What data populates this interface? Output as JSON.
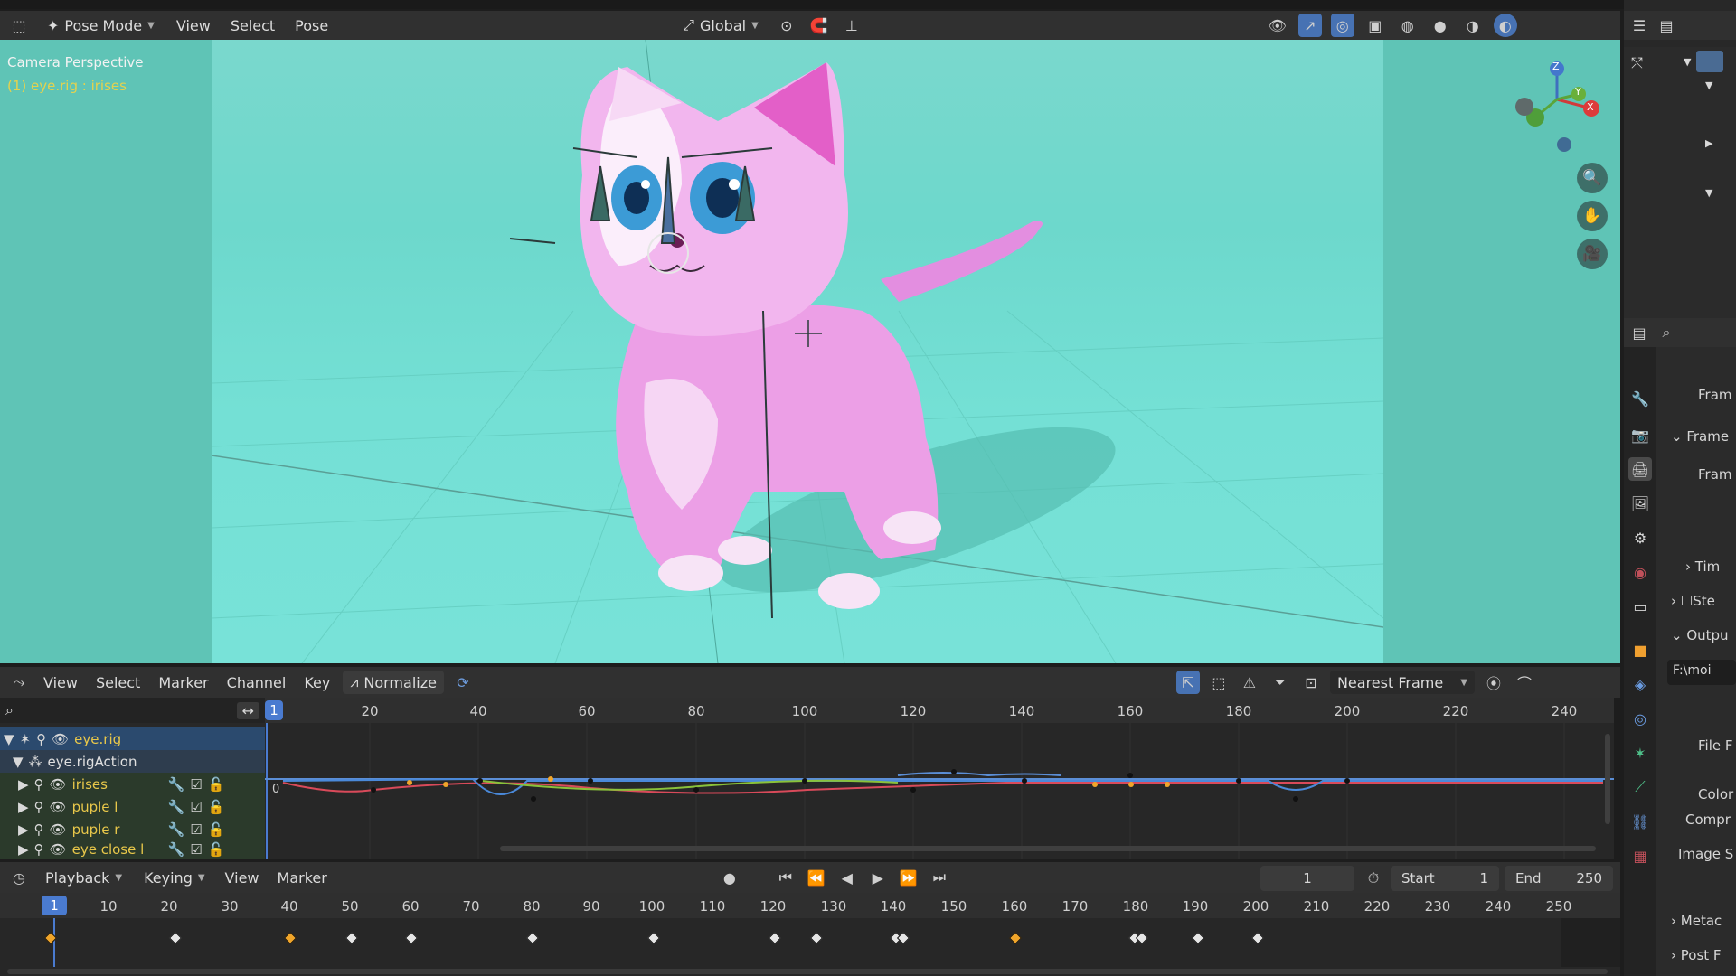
{
  "header": {
    "mode": "Pose Mode",
    "menus": [
      "View",
      "Select",
      "Pose"
    ],
    "orientation": "Global"
  },
  "viewport": {
    "perspective_label": "Camera Perspective",
    "object_label": "(1) eye.rig : irises",
    "gizmo_axes": {
      "z": "Z",
      "y": "Y",
      "x": "X"
    },
    "nav_icons": [
      "zoom-icon",
      "hand-pan-icon",
      "camera-icon"
    ]
  },
  "graph_editor": {
    "menus": [
      "View",
      "Select",
      "Marker",
      "Channel",
      "Key"
    ],
    "normalize_label": "Normalize",
    "snap_mode": "Nearest Frame",
    "current_frame": "1",
    "ruler_ticks": [
      "20",
      "40",
      "60",
      "80",
      "100",
      "120",
      "140",
      "160",
      "180",
      "200",
      "220",
      "240"
    ],
    "zero_label": "0",
    "channels": [
      {
        "label": "eye.rig",
        "level": 0
      },
      {
        "label": "eye.rigAction",
        "level": 1
      },
      {
        "label": "irises",
        "level": 2
      },
      {
        "label": "puple l",
        "level": 2
      },
      {
        "label": "puple r",
        "level": 2
      },
      {
        "label": "eye close l",
        "level": 2
      }
    ]
  },
  "timeline": {
    "menus": [
      "Playback",
      "Keying",
      "View",
      "Marker"
    ],
    "current_frame": "1",
    "frame_field": "1",
    "start_label": "Start",
    "start_value": "1",
    "end_label": "End",
    "end_value": "250",
    "ruler_ticks": [
      "10",
      "20",
      "30",
      "40",
      "50",
      "60",
      "70",
      "80",
      "90",
      "100",
      "110",
      "120",
      "130",
      "140",
      "150",
      "160",
      "170",
      "180",
      "190",
      "200",
      "210",
      "220",
      "230",
      "240",
      "250"
    ]
  },
  "properties": {
    "labels": [
      "Fram",
      "Frame",
      "Fram",
      "Tim",
      "Ste",
      "Outpu",
      "F:\\moi",
      "File F",
      "Color",
      "Compr",
      "Image S",
      "Metac",
      "Post F"
    ]
  },
  "colors": {
    "panel_bg": "#303030",
    "viewport_bg": "#6dd8cc",
    "selected_row": "#2b4a6e",
    "keyframe_selected": "#f0a52a",
    "channel_text": "#e8c74a",
    "frame_indicator": "#4a7bd0"
  }
}
